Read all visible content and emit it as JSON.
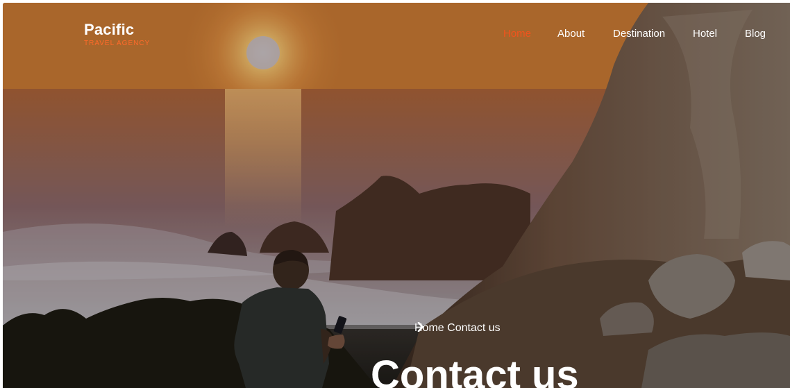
{
  "brand": {
    "name": "Pacific",
    "tagline": "Travel Agency"
  },
  "nav": {
    "items": [
      {
        "label": "Home",
        "active": true
      },
      {
        "label": "About",
        "active": false
      },
      {
        "label": "Destination",
        "active": false
      },
      {
        "label": "Hotel",
        "active": false
      },
      {
        "label": "Blog",
        "active": false
      }
    ]
  },
  "breadcrumb": {
    "home": "Home",
    "current": "Contact us"
  },
  "page": {
    "title": "Contact us"
  },
  "colors": {
    "accent": "#f2531d",
    "text": "#ffffff"
  },
  "icons": {
    "breadcrumb_separator": "chevron-right-icon"
  }
}
